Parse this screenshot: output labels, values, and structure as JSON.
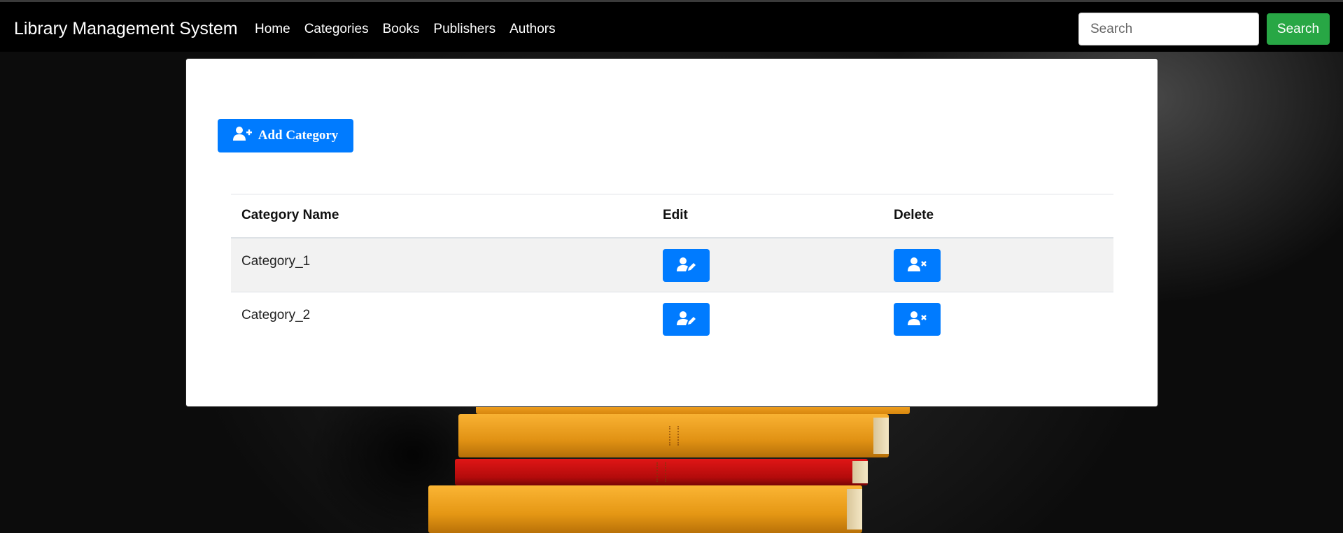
{
  "navbar": {
    "brand": "Library Management System",
    "links": [
      "Home",
      "Categories",
      "Books",
      "Publishers",
      "Authors"
    ],
    "search": {
      "placeholder": "Search",
      "button_label": "Search"
    }
  },
  "main": {
    "add_button_label": "Add Category",
    "table": {
      "headers": [
        "Category Name",
        "Edit",
        "Delete"
      ],
      "rows": [
        {
          "name": "Category_1",
          "edit_icon": "user-edit-icon",
          "delete_icon": "user-delete-icon"
        },
        {
          "name": "Category_2",
          "edit_icon": "user-edit-icon",
          "delete_icon": "user-delete-icon"
        }
      ]
    }
  },
  "colors": {
    "navbar": "#000000",
    "primary": "#007bff",
    "success": "#28a745",
    "card": "#ffffff"
  }
}
